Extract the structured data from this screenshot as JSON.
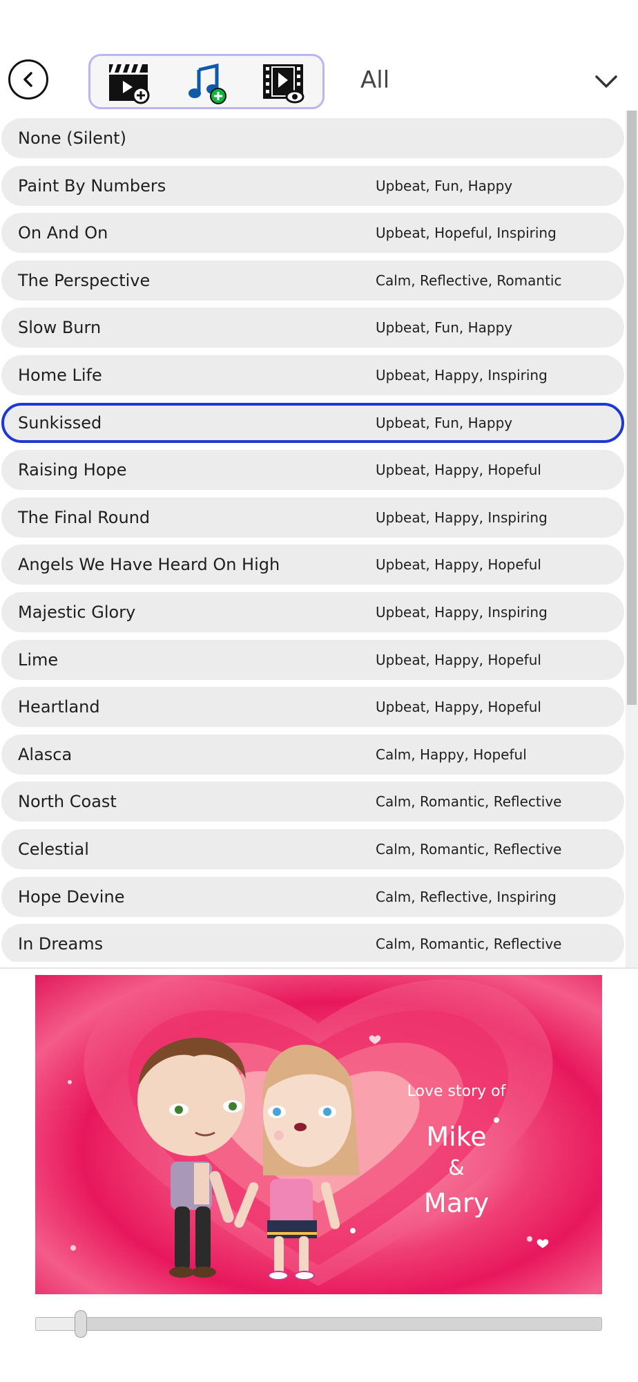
{
  "toolbar": {
    "back_icon": "chevron-left-icon",
    "tools": [
      {
        "name": "add-video-clip",
        "icon": "clapperboard-plus-icon"
      },
      {
        "name": "add-music",
        "icon": "music-note-plus-icon"
      },
      {
        "name": "preview-video",
        "icon": "film-eye-icon"
      }
    ],
    "filter_selected": "All",
    "filter_icon": "chevron-down-icon",
    "accent_color": "#b9b4f3"
  },
  "music_list": {
    "selected_index": 6,
    "selected_color": "#1c37d3",
    "items": [
      {
        "title": "None (Silent)",
        "tags": ""
      },
      {
        "title": "Paint By Numbers",
        "tags": "Upbeat, Fun, Happy"
      },
      {
        "title": "On And On",
        "tags": "Upbeat, Hopeful, Inspiring"
      },
      {
        "title": "The Perspective",
        "tags": "Calm, Reflective, Romantic"
      },
      {
        "title": "Slow Burn",
        "tags": "Upbeat, Fun, Happy"
      },
      {
        "title": "Home Life",
        "tags": "Upbeat, Happy, Inspiring"
      },
      {
        "title": "Sunkissed",
        "tags": "Upbeat, Fun, Happy"
      },
      {
        "title": "Raising Hope",
        "tags": "Upbeat, Happy, Hopeful"
      },
      {
        "title": "The Final Round",
        "tags": "Upbeat, Happy, Inspiring"
      },
      {
        "title": "Angels We Have Heard On High",
        "tags": "Upbeat, Happy, Hopeful"
      },
      {
        "title": "Majestic Glory",
        "tags": "Upbeat, Happy, Inspiring"
      },
      {
        "title": "Lime",
        "tags": "Upbeat, Happy, Hopeful"
      },
      {
        "title": "Heartland",
        "tags": "Upbeat, Happy, Hopeful"
      },
      {
        "title": "Alasca",
        "tags": "Calm, Happy, Hopeful"
      },
      {
        "title": "North Coast",
        "tags": "Calm, Romantic, Reflective"
      },
      {
        "title": "Celestial",
        "tags": "Calm, Romantic, Reflective"
      },
      {
        "title": "Hope Devine",
        "tags": "Calm, Reflective, Inspiring"
      },
      {
        "title": "In Dreams",
        "tags": "Calm, Romantic, Reflective"
      }
    ]
  },
  "preview": {
    "caption_small": "Love story of",
    "name_1": "Mike",
    "ampersand": "&",
    "name_2": "Mary",
    "background_color": "#e8175d"
  },
  "timeline": {
    "progress_fraction": 0.08
  }
}
